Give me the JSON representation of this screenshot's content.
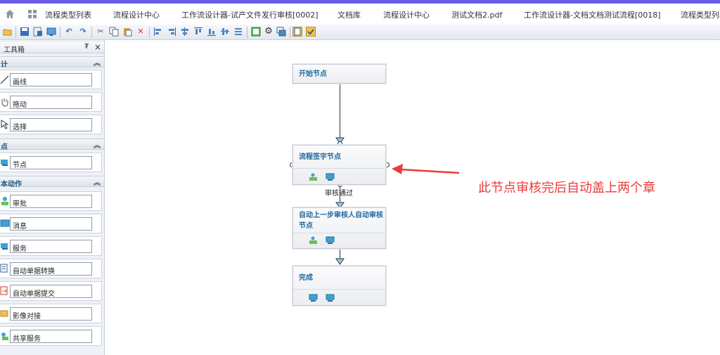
{
  "tabs": [
    {
      "label": "流程类型列表"
    },
    {
      "label": "流程设计中心"
    },
    {
      "label": "工作流设计器-试产文件发行审核[0002]"
    },
    {
      "label": "文档库"
    },
    {
      "label": "流程设计中心"
    },
    {
      "label": "测试文档2.pdf"
    },
    {
      "label": "工作流设计器-文档文档测试流程[0018]"
    },
    {
      "label": "流程类型列表"
    }
  ],
  "toolbox": {
    "title": "工具箱",
    "pin": "₮",
    "close": "×",
    "sections": [
      {
        "label": "计",
        "items": [
          {
            "label": "画线"
          },
          {
            "label": "拖动"
          },
          {
            "label": "选择"
          }
        ]
      },
      {
        "label": "点",
        "items": [
          {
            "label": "节点"
          }
        ]
      },
      {
        "label": "本动作",
        "items": [
          {
            "label": "审批"
          },
          {
            "label": "消息"
          },
          {
            "label": "服务"
          },
          {
            "label": "自动单据转换"
          },
          {
            "label": "自动单据提交"
          },
          {
            "label": "影像对接"
          },
          {
            "label": "共享服务"
          }
        ]
      }
    ]
  },
  "flow": {
    "nodes": [
      {
        "title": "开始节点"
      },
      {
        "title": "流程签字节点"
      },
      {
        "title": "自动上一步审核人自动审核节点"
      },
      {
        "title": "完成"
      }
    ],
    "edge_label": "审核通过"
  },
  "annotation": {
    "text": "此节点审核完后自动盖上两个章",
    "color": "#ea3b3b"
  },
  "colors": {
    "accent_strip": "#6a5be6",
    "node_title": "#1e6a9e",
    "section_title": "#1f5a86"
  }
}
